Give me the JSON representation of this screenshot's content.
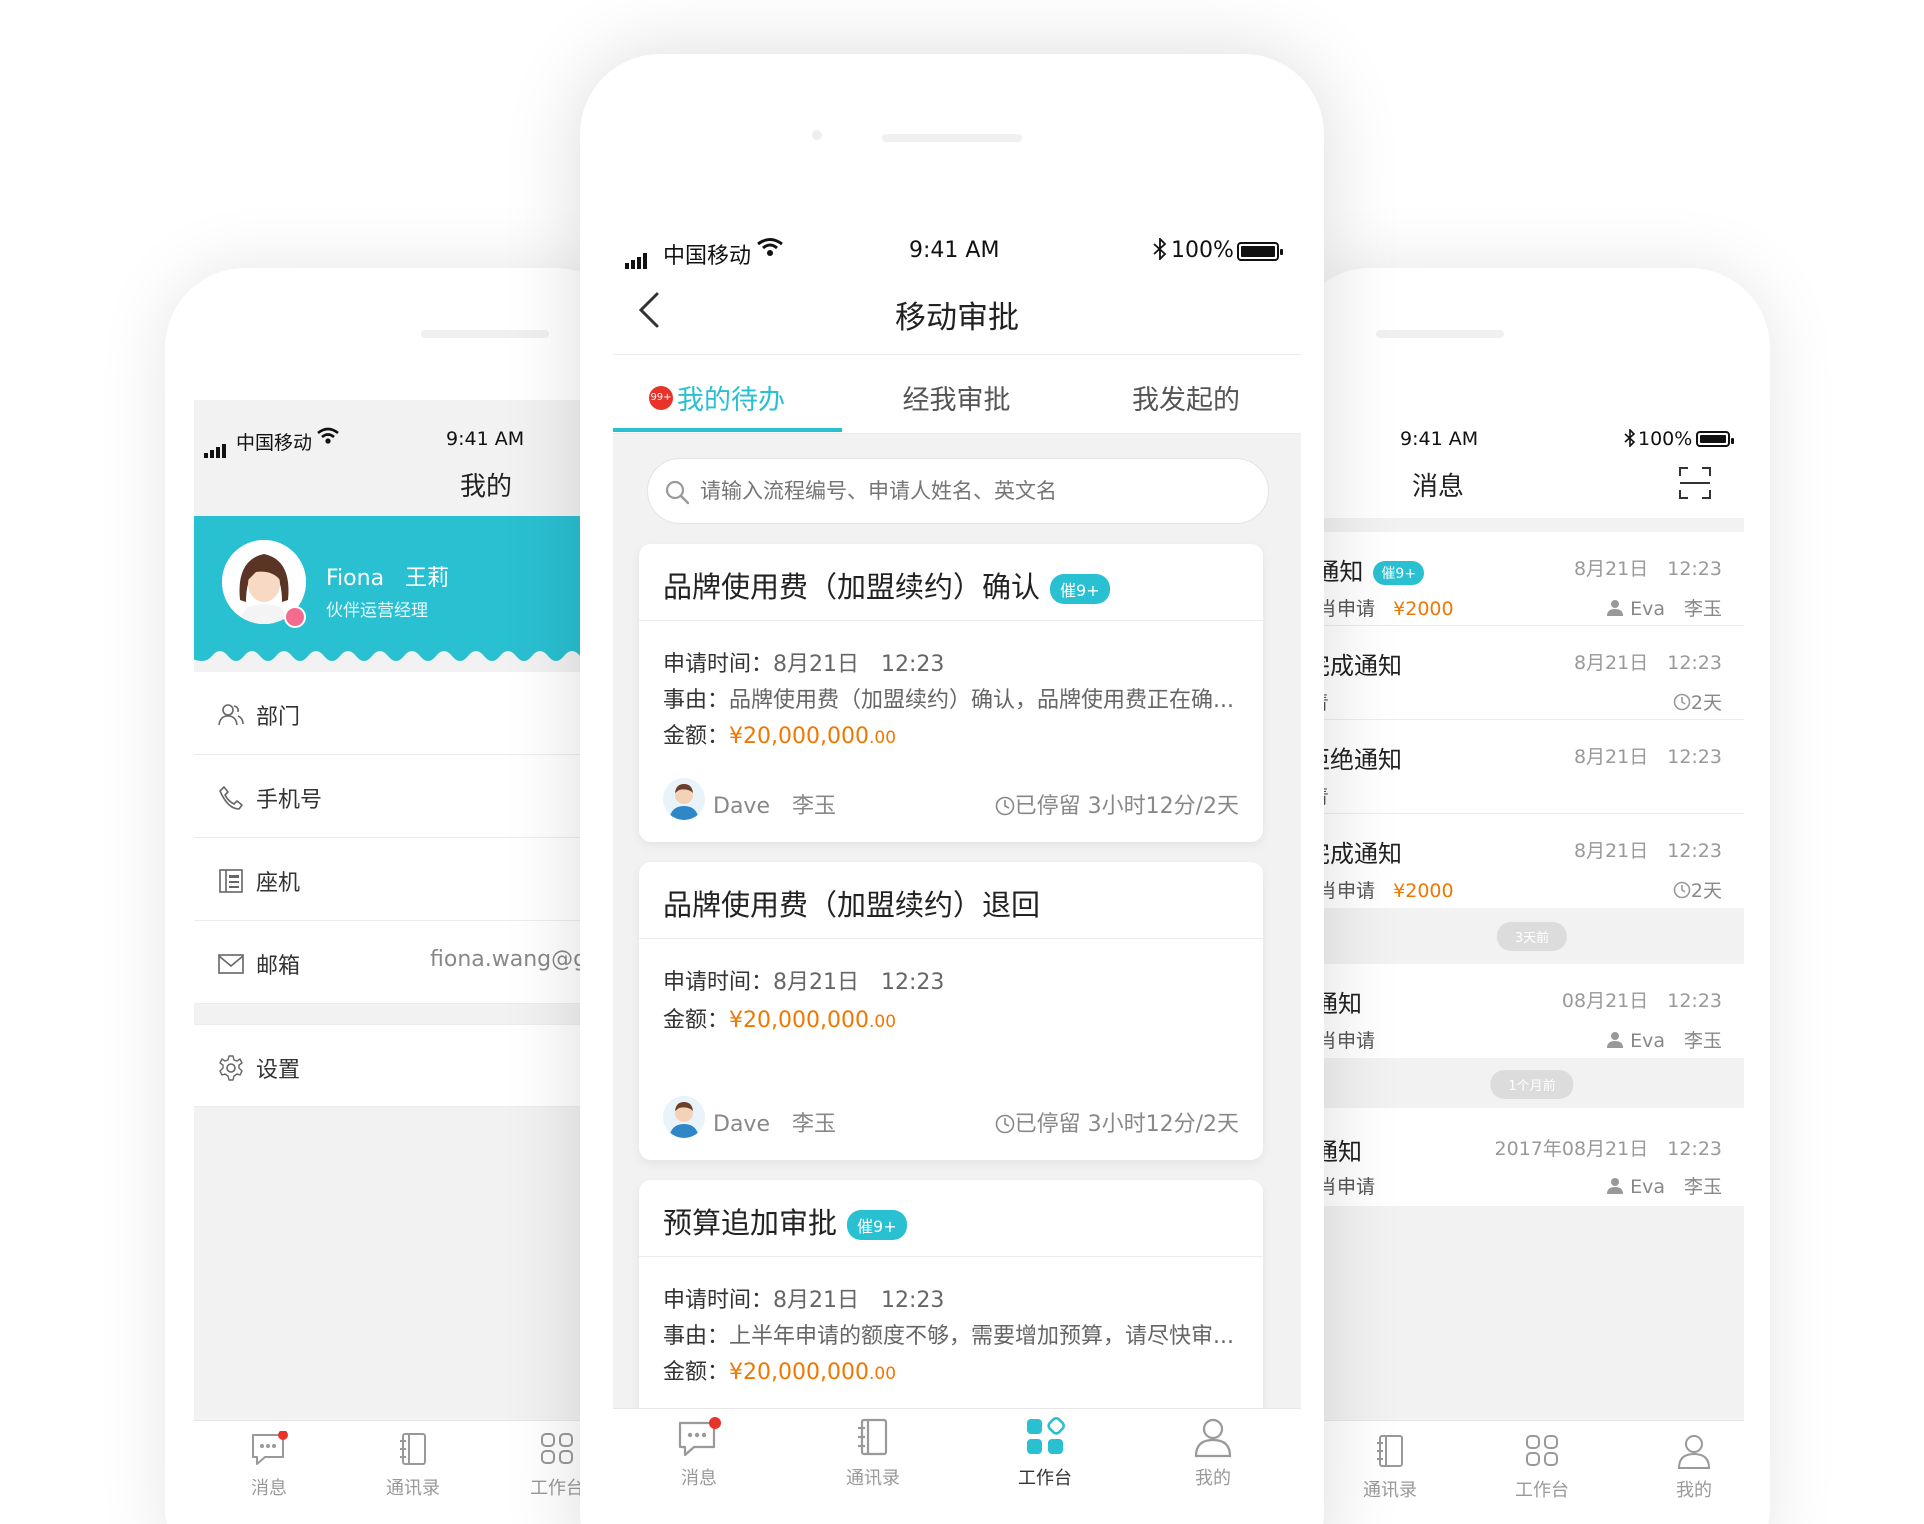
{
  "left_phone": {
    "status": {
      "carrier": "中国移动",
      "time": "9:41 AM"
    },
    "title": "我的",
    "profile": {
      "name_en": "Fiona",
      "name_cn": "王莉",
      "role": "伙伴运营经理"
    },
    "rows": [
      {
        "icon": "people-icon",
        "label": "部门",
        "value": ""
      },
      {
        "icon": "phone-icon",
        "label": "手机号",
        "value": ""
      },
      {
        "icon": "landline-icon",
        "label": "座机",
        "value": ""
      },
      {
        "icon": "mail-icon",
        "label": "邮箱",
        "value": "fiona.wang@g"
      }
    ],
    "settings_label": "设置",
    "tabs": [
      {
        "icon": "message-icon",
        "label": "消息"
      },
      {
        "icon": "contacts-icon",
        "label": "通讯录"
      },
      {
        "icon": "workbench-icon",
        "label": "工作台"
      }
    ]
  },
  "center_phone": {
    "status": {
      "carrier": "中国移动",
      "time": "9:41 AM",
      "battery": "100%"
    },
    "title": "移动审批",
    "tabs": [
      {
        "label": "我的待办",
        "badge": "99+",
        "active": true
      },
      {
        "label": "经我审批"
      },
      {
        "label": "我发起的"
      }
    ],
    "search_placeholder": "请输入流程编号、申请人姓名、英文名",
    "cards": [
      {
        "title": "品牌使用费（加盟续约）确认",
        "badge": "催9+",
        "time_label": "申请时间：",
        "time": "8月21日　12:23",
        "reason_label": "事由：",
        "reason": "品牌使用费（加盟续约）确认，品牌使用费正在确...",
        "amount_label": "金额：",
        "amount_main": "¥20,000,000",
        "amount_dec": ".00",
        "person": "Dave　李玉",
        "stay": "已停留 3小时12分/2天"
      },
      {
        "title": "品牌使用费（加盟续约）退回",
        "time_label": "申请时间：",
        "time": "8月21日　12:23",
        "amount_label": "金额：",
        "amount_main": "¥20,000,000",
        "amount_dec": ".00",
        "person": "Dave　李玉",
        "stay": "已停留 3小时12分/2天"
      },
      {
        "title": "预算追加审批",
        "badge": "催9+",
        "time_label": "申请时间：",
        "time": "8月21日　12:23",
        "reason_label": "事由：",
        "reason": "上半年申请的额度不够，需要增加预算，请尽快审...",
        "amount_label": "金额：",
        "amount_main": "¥20,000,000",
        "amount_dec": ".00"
      }
    ],
    "bottom_tabs": [
      {
        "icon": "message-icon",
        "label": "消息"
      },
      {
        "icon": "contacts-icon",
        "label": "通讯录"
      },
      {
        "icon": "workbench-icon",
        "label": "工作台",
        "active": true
      },
      {
        "icon": "user-icon",
        "label": "我的"
      }
    ],
    "accent": "#29c0d2"
  },
  "right_phone": {
    "status": {
      "time": "9:41 AM",
      "battery": "100%"
    },
    "title": "消息",
    "items": [
      {
        "title": "t通知",
        "badge": "催9+",
        "date": "8月21日　12:23",
        "sub": "肖申请",
        "amount": "¥2000",
        "meta": "Eva　李玉",
        "meta_icon": "person-icon"
      },
      {
        "title": "完成通知",
        "date": "8月21日　12:23",
        "sub": "青",
        "meta": "2天",
        "meta_icon": "clock-icon"
      },
      {
        "title": "拒绝通知",
        "date": "8月21日　12:23",
        "sub": "青"
      },
      {
        "title": "完成通知",
        "date": "8月21日　12:23",
        "sub": "肖申请",
        "amount": "¥2000",
        "meta": "2天",
        "meta_icon": "clock-icon"
      }
    ],
    "sep1": "3天前",
    "items2": [
      {
        "title": "通知",
        "date": "08月21日　12:23",
        "sub": "肖申请",
        "meta": "Eva　李玉",
        "meta_icon": "person-icon"
      }
    ],
    "sep2": "1个月前",
    "items3": [
      {
        "title": "通知",
        "date": "2017年08月21日　12:23",
        "sub": "肖申请",
        "meta": "Eva　李玉",
        "meta_icon": "person-icon"
      }
    ],
    "tabs": [
      {
        "icon": "contacts-icon",
        "label": "通讯录"
      },
      {
        "icon": "workbench-icon",
        "label": "工作台"
      },
      {
        "icon": "user-icon",
        "label": "我的"
      }
    ]
  }
}
